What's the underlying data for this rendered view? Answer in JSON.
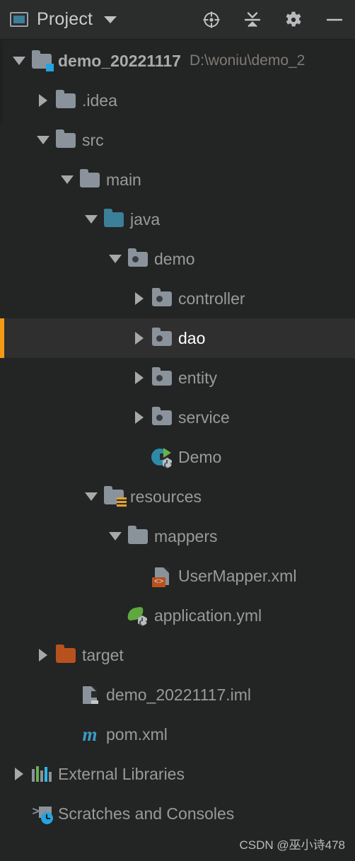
{
  "window": {
    "title": "Project",
    "title_icon": "project-view-icon",
    "dropdown_icon": "chevron-down-icon"
  },
  "toolbar": {
    "buttons": [
      {
        "name": "select-opened-file-icon",
        "label": ""
      },
      {
        "name": "collapse-all-icon",
        "label": ""
      },
      {
        "name": "gear-icon",
        "label": ""
      },
      {
        "name": "hide-icon",
        "label": ""
      }
    ]
  },
  "tree": {
    "rows": [
      {
        "label": "demo_20221117",
        "suffix": "D:\\woniu\\demo_2",
        "depth": 0,
        "toggle": "open",
        "icon": "module-folder-icon",
        "bold": true,
        "selected": false
      },
      {
        "label": ".idea",
        "suffix": "",
        "depth": 1,
        "toggle": "closed",
        "icon": "folder-icon",
        "bold": false,
        "selected": false
      },
      {
        "label": "src",
        "suffix": "",
        "depth": 1,
        "toggle": "open",
        "icon": "folder-icon",
        "bold": false,
        "selected": false
      },
      {
        "label": "main",
        "suffix": "",
        "depth": 2,
        "toggle": "open",
        "icon": "folder-icon",
        "bold": false,
        "selected": false
      },
      {
        "label": "java",
        "suffix": "",
        "depth": 3,
        "toggle": "open",
        "icon": "source-root-folder-icon",
        "bold": false,
        "selected": false
      },
      {
        "label": "demo",
        "suffix": "",
        "depth": 4,
        "toggle": "open",
        "icon": "package-folder-icon",
        "bold": false,
        "selected": false
      },
      {
        "label": "controller",
        "suffix": "",
        "depth": 5,
        "toggle": "closed",
        "icon": "package-folder-icon",
        "bold": false,
        "selected": false
      },
      {
        "label": "dao",
        "suffix": "",
        "depth": 5,
        "toggle": "closed",
        "icon": "package-folder-icon",
        "bold": false,
        "selected": true
      },
      {
        "label": "entity",
        "suffix": "",
        "depth": 5,
        "toggle": "closed",
        "icon": "package-folder-icon",
        "bold": false,
        "selected": false
      },
      {
        "label": "service",
        "suffix": "",
        "depth": 5,
        "toggle": "closed",
        "icon": "package-folder-icon",
        "bold": false,
        "selected": false
      },
      {
        "label": "Demo",
        "suffix": "",
        "depth": 5,
        "toggle": "none",
        "icon": "spring-boot-class-icon",
        "bold": false,
        "selected": false
      },
      {
        "label": "resources",
        "suffix": "",
        "depth": 3,
        "toggle": "open",
        "icon": "resources-folder-icon",
        "bold": false,
        "selected": false
      },
      {
        "label": "mappers",
        "suffix": "",
        "depth": 4,
        "toggle": "open",
        "icon": "folder-icon",
        "bold": false,
        "selected": false
      },
      {
        "label": "UserMapper.xml",
        "suffix": "",
        "depth": 5,
        "toggle": "none",
        "icon": "xml-file-icon",
        "bold": false,
        "selected": false
      },
      {
        "label": "application.yml",
        "suffix": "",
        "depth": 4,
        "toggle": "none",
        "icon": "spring-yaml-file-icon",
        "bold": false,
        "selected": false
      },
      {
        "label": "target",
        "suffix": "",
        "depth": 1,
        "toggle": "closed",
        "icon": "excluded-folder-icon",
        "bold": false,
        "selected": false
      },
      {
        "label": "demo_20221117.iml",
        "suffix": "",
        "depth": 2,
        "toggle": "none",
        "icon": "iml-file-icon",
        "bold": false,
        "selected": false
      },
      {
        "label": "pom.xml",
        "suffix": "",
        "depth": 2,
        "toggle": "none",
        "icon": "maven-file-icon",
        "bold": false,
        "selected": false
      },
      {
        "label": "External Libraries",
        "suffix": "",
        "depth": 0,
        "toggle": "closed",
        "icon": "libraries-icon",
        "bold": false,
        "selected": false
      },
      {
        "label": "Scratches and Consoles",
        "suffix": "",
        "depth": 0,
        "toggle": "none",
        "icon": "scratches-icon",
        "bold": false,
        "selected": false
      }
    ]
  },
  "watermark": {
    "text": "CSDN @巫小诗478"
  },
  "colors": {
    "background": "#232424",
    "header_background": "#2B2C2C",
    "selection_background": "#2F2F2F",
    "selection_accent": "#F29A14",
    "text": "#9A9A98",
    "selected_text": "#FFFFFF",
    "path_text": "#7E7B76",
    "folder_gray": "#8A939B",
    "folder_teal": "#3C7F98",
    "folder_orange": "#B7521F",
    "maven_blue": "#3C9BC4",
    "spring_green": "#5FA83D",
    "badge_blue": "#24A3E0"
  }
}
